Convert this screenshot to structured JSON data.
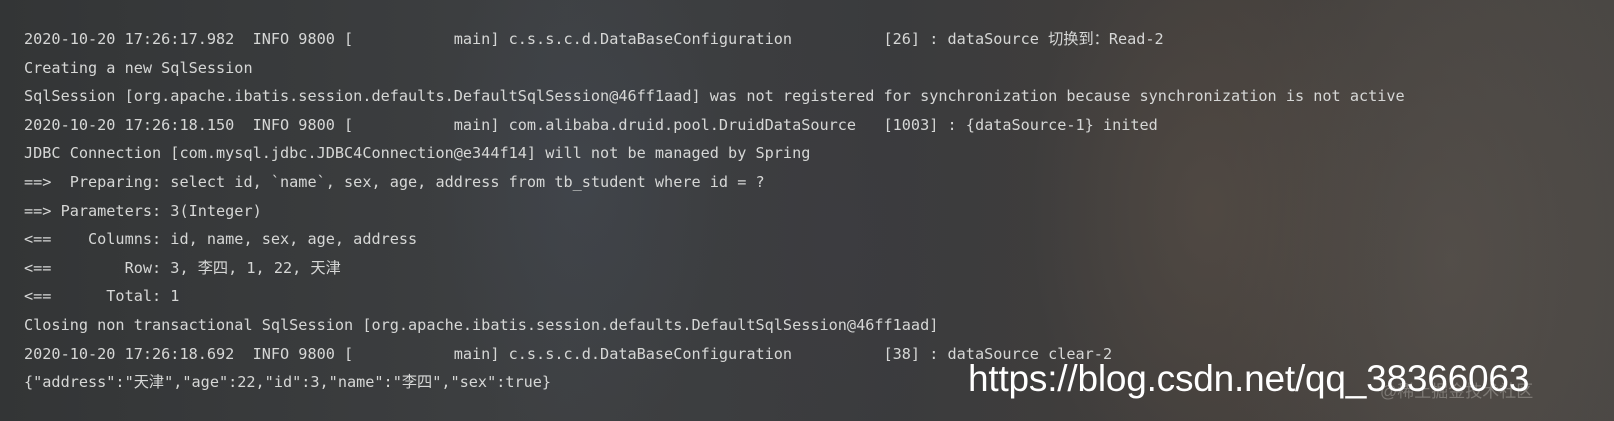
{
  "console": {
    "lines": [
      "2020-10-20 17:26:17.982  INFO 9800 [           main] c.s.s.c.d.DataBaseConfiguration          [26] : dataSource 切换到：Read-2",
      "Creating a new SqlSession",
      "SqlSession [org.apache.ibatis.session.defaults.DefaultSqlSession@46ff1aad] was not registered for synchronization because synchronization is not active",
      "2020-10-20 17:26:18.150  INFO 9800 [           main] com.alibaba.druid.pool.DruidDataSource   [1003] : {dataSource-1} inited",
      "JDBC Connection [com.mysql.jdbc.JDBC4Connection@e344f14] will not be managed by Spring",
      "==>  Preparing: select id, `name`, sex, age, address from tb_student where id = ?",
      "==> Parameters: 3(Integer)",
      "<==    Columns: id, name, sex, age, address",
      "<==        Row: 3, 李四, 1, 22, 天津",
      "<==      Total: 1",
      "Closing non transactional SqlSession [org.apache.ibatis.session.defaults.DefaultSqlSession@46ff1aad]",
      "2020-10-20 17:26:18.692  INFO 9800 [           main] c.s.s.c.d.DataBaseConfiguration          [38] : dataSource clear-2",
      "{\"address\":\"天津\",\"age\":22,\"id\":3,\"name\":\"李四\",\"sex\":true}"
    ]
  },
  "watermark": {
    "url": "https://blog.csdn.net/qq_38366063",
    "faint": "@稀土掘金技术社区"
  },
  "colors": {
    "text": "#d6d7d6",
    "background": "#3a3c3d",
    "watermark": "#ffffff"
  }
}
